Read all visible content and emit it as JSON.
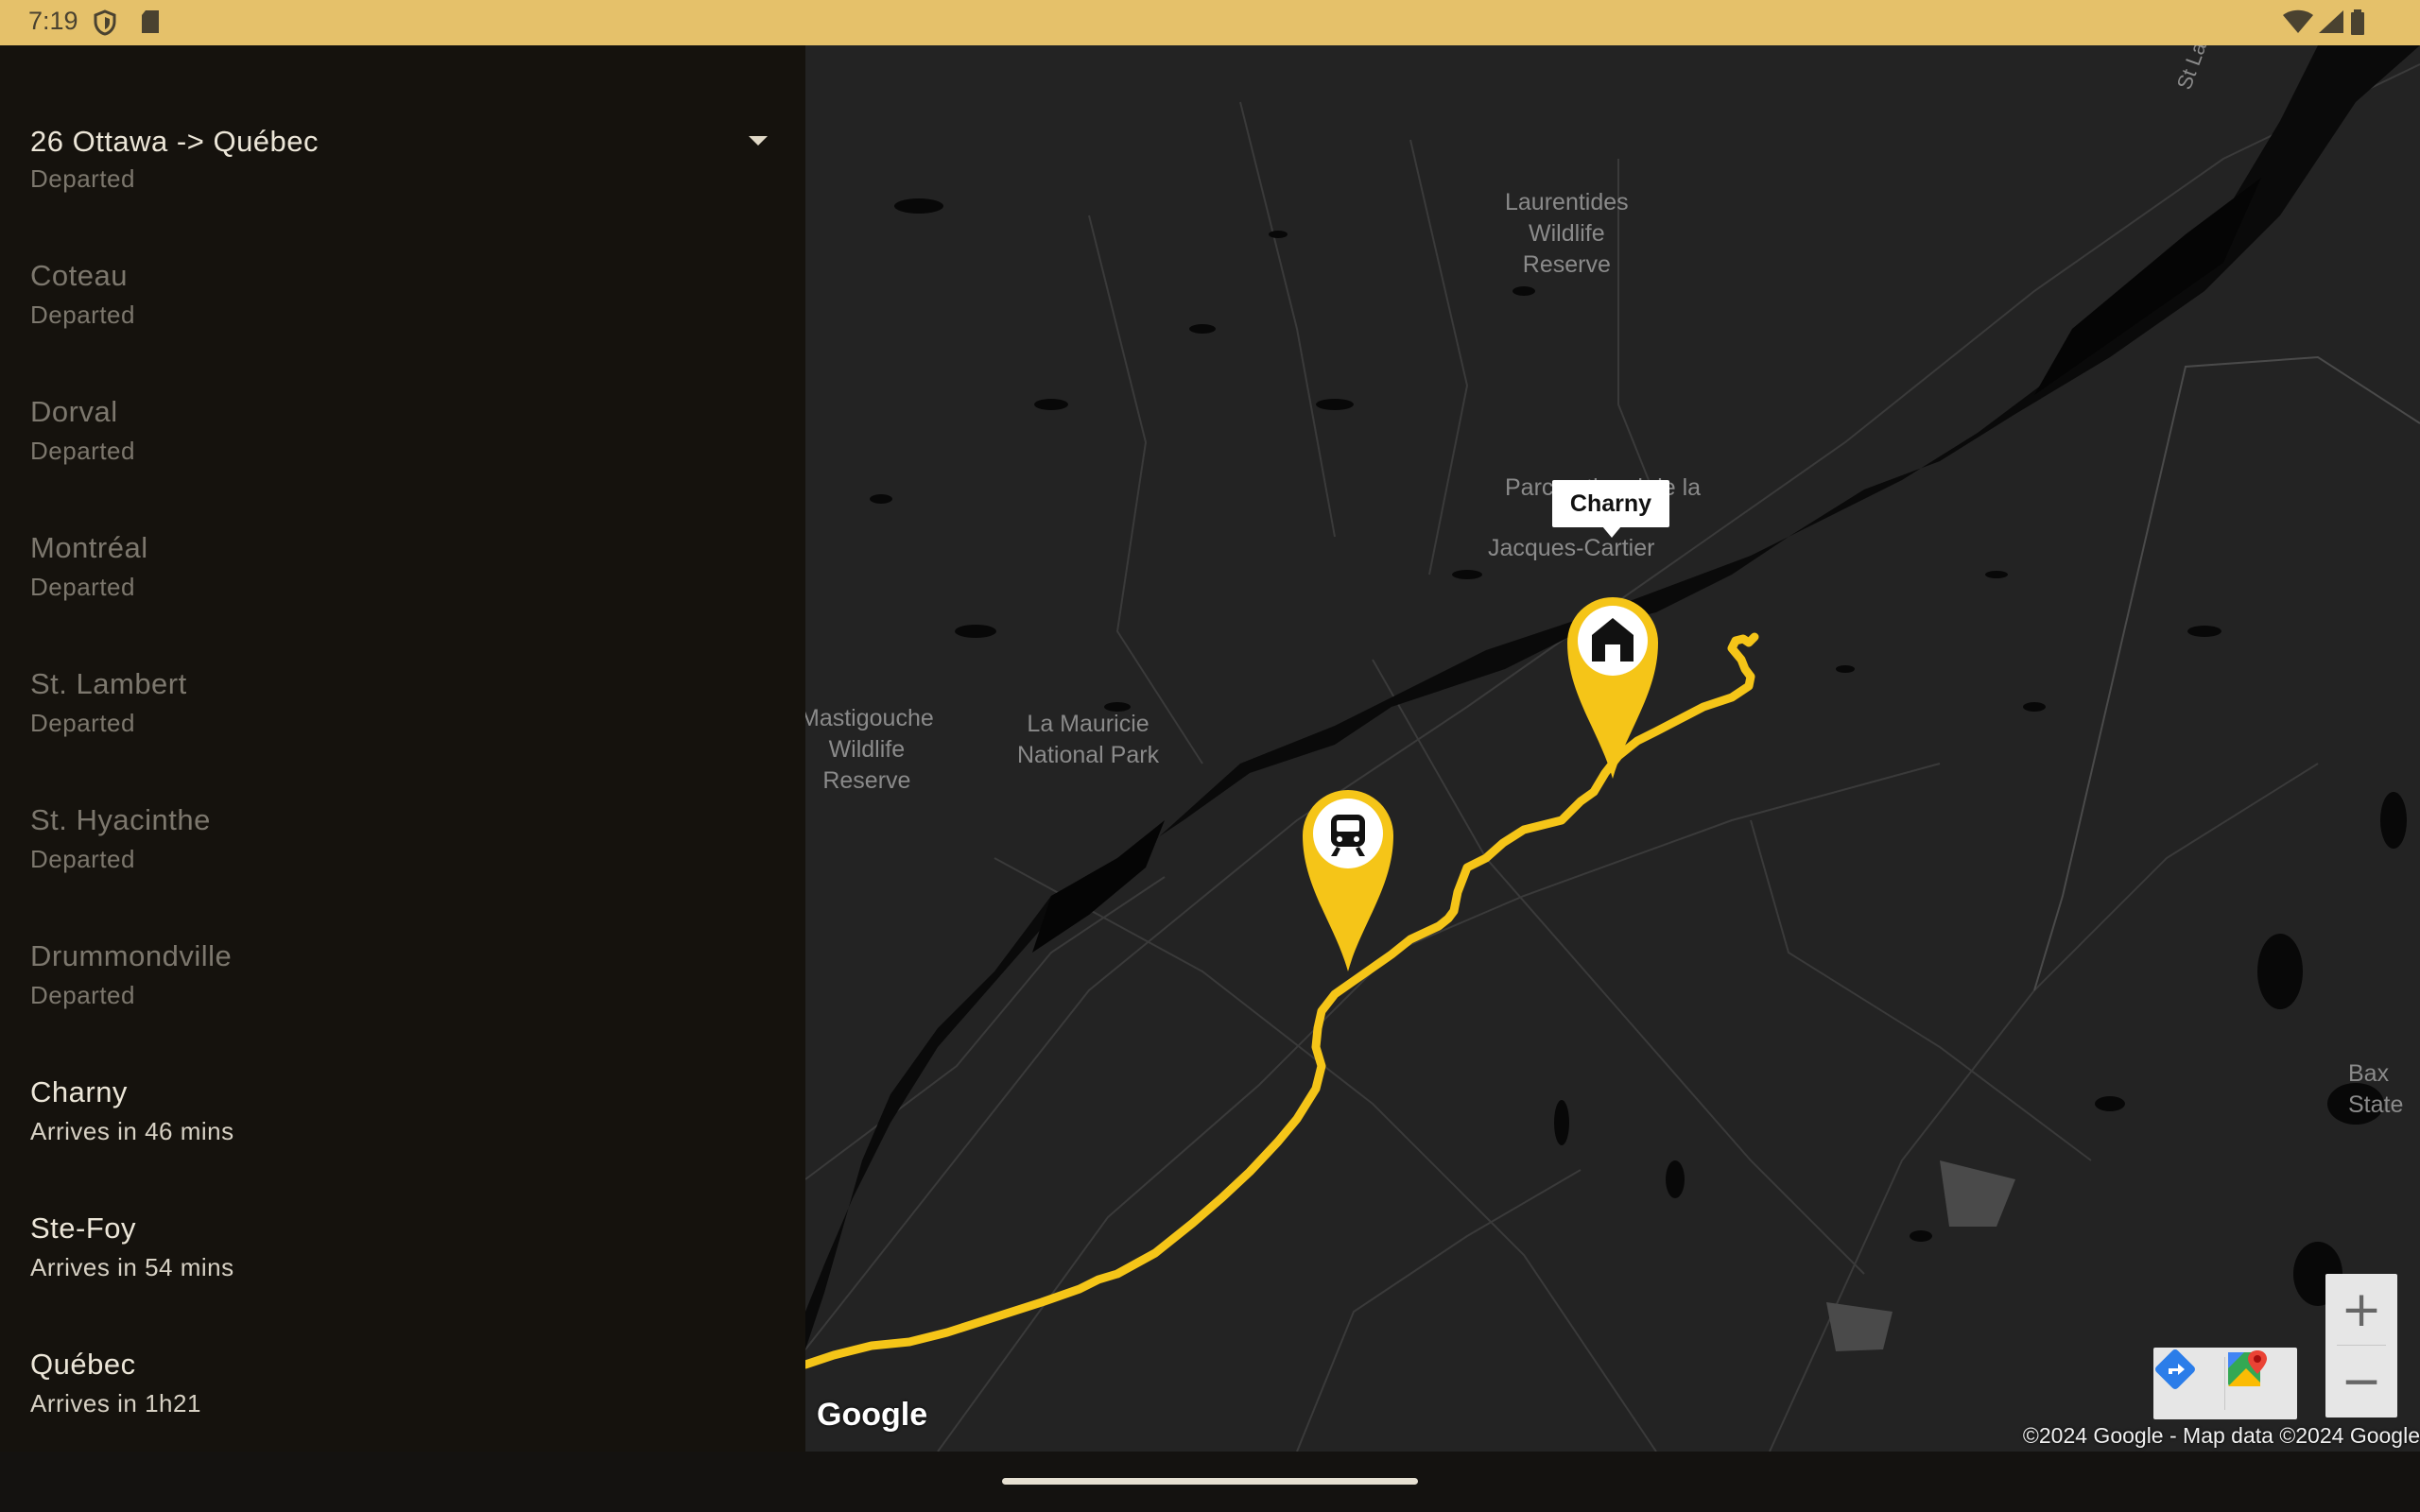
{
  "status_bar": {
    "time": "7:19",
    "left_icons": [
      "shield-icon",
      "sd-card-icon"
    ],
    "right_icons": [
      "wifi-icon",
      "cell-signal-icon",
      "battery-icon"
    ],
    "background": "#e5c16a"
  },
  "route": {
    "selected": "26 Ottawa -> Québec"
  },
  "stops": [
    {
      "name": "",
      "status": "Departed",
      "state": "past"
    },
    {
      "name": "Coteau",
      "status": "Departed",
      "state": "past"
    },
    {
      "name": "Dorval",
      "status": "Departed",
      "state": "past"
    },
    {
      "name": "Montréal",
      "status": "Departed",
      "state": "past"
    },
    {
      "name": "St. Lambert",
      "status": "Departed",
      "state": "past"
    },
    {
      "name": "St. Hyacinthe",
      "status": "Departed",
      "state": "past"
    },
    {
      "name": "Drummondville",
      "status": "Departed",
      "state": "past"
    },
    {
      "name": "Charny",
      "status": "Arrives in 46 mins",
      "state": "future"
    },
    {
      "name": "Ste-Foy",
      "status": "Arrives in 54 mins",
      "state": "future"
    },
    {
      "name": "Québec",
      "status": "Arrives in 1h21",
      "state": "future"
    }
  ],
  "map": {
    "labels": {
      "laurentides": "Laurentides\nWildlife\nReserve",
      "parc": "Parc national de la",
      "jacques": "Jacques-Cartier",
      "mastigouche": "Mastigouche\nWildlife\nReserve",
      "mauricie": "La Mauricie\nNational Park",
      "st_lawrence": "St Lawre",
      "baxter": "Bax\nState"
    },
    "tooltip": "Charny",
    "route_color": "#f5c518",
    "markers": [
      "train-icon",
      "home-icon"
    ],
    "logo": "Google",
    "copyright": "©2024 Google - Map data ©2024 Google",
    "zoom_in": "+",
    "zoom_out": "−"
  }
}
